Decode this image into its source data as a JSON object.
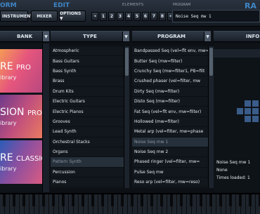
{
  "header": {
    "form_label": "ORM",
    "edit_label": "EDIT",
    "elements_label": "ELEMENTS",
    "program_label": "PROGRAM",
    "ra_label": "RA",
    "instrument_button": "INSTRUMENT",
    "mixer_button": "MIXER",
    "options_button": "OPTIONS ▼",
    "elements": [
      "◂",
      "1",
      "2",
      "3",
      "4",
      "5",
      "6",
      "7",
      "8",
      "▸"
    ],
    "program_name": "Noise Seq mw 1"
  },
  "columns": {
    "bank": "BANK",
    "type": "TYPE",
    "program": "PROGRAM",
    "info": "INFO",
    "dropdown_glyph": "▼"
  },
  "banks": [
    {
      "title": "RE",
      "suffix": "PRO",
      "subtitle": "ibrary"
    },
    {
      "title": "SION",
      "suffix": "PRO",
      "subtitle": "ibrary"
    },
    {
      "title": "RE",
      "suffix": "CLASSIC",
      "subtitle": "ibrary"
    }
  ],
  "types": [
    "Atmospheric",
    "Bass Guitars",
    "Bass Synth",
    "Brass",
    "Drum Kits",
    "Electric Guitars",
    "Electric Pianos",
    "Grooves",
    "Lead Synth",
    "Orchestral Stacks",
    "Organs",
    "Pattern Synth",
    "Percussion",
    "Pianos"
  ],
  "selected_type_index": 11,
  "programs": [
    "Bandpassed Seq (vel=flt env, mw=filt",
    "Butter Seq (mw=filter)",
    "Crunchy Seq (mw=filter1, PB=filt",
    "Crushed phaser (vel=filter, mw",
    "Dirty Seq (mw=filter)",
    "Disto Seq (mw=filter)",
    "Fat Seq (vel=flt env, mw=filter)",
    "Hollowed (mw=filter)",
    "Metal arp (vel=filter, mw=phase",
    "Noise Seq mw 1",
    "Noise Seq mw 2",
    "Phased ringer (vel=filter, mw=",
    "Pulse Seq mw",
    "Reso arp (vel=filter, mw=reso)"
  ],
  "selected_program_index": 9,
  "info": {
    "name": "Noise Seq mw 1",
    "line2": "None",
    "line3": "Times loaded: 1"
  }
}
